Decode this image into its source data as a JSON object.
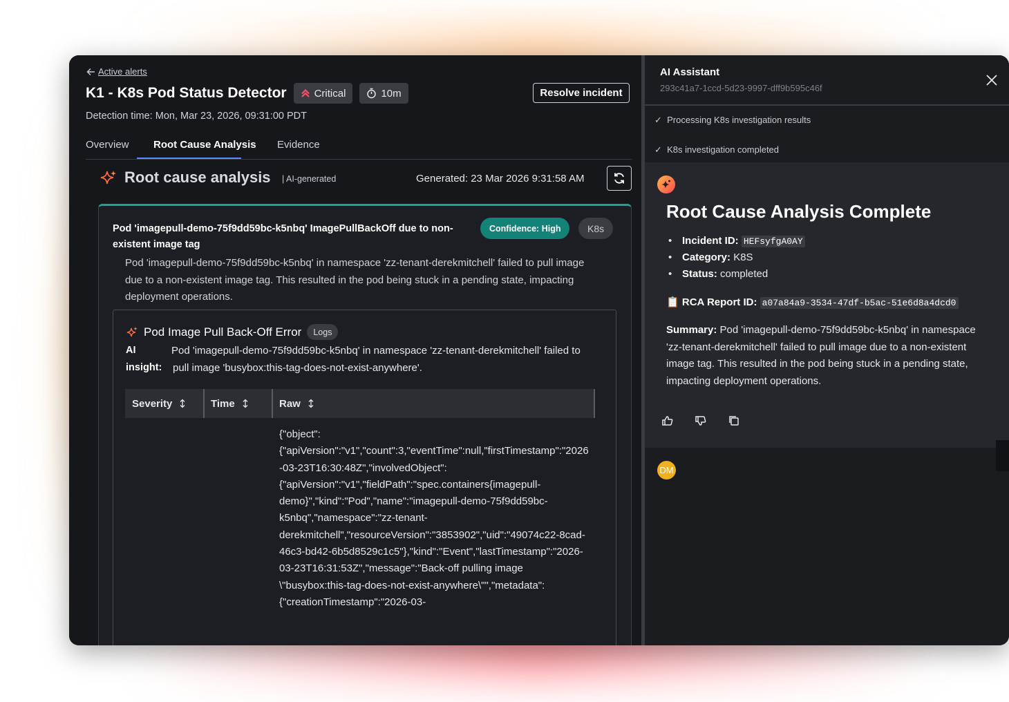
{
  "header": {
    "back_label": "Active alerts",
    "title": "K1 - K8s Pod Status Detector",
    "severity_label": "Critical",
    "duration_label": "10m",
    "resolve_label": "Resolve incident",
    "detection_time": "Detection time: Mon, Mar 23, 2026, 09:31:00 PDT"
  },
  "tabs": [
    {
      "label": "Overview",
      "active": false
    },
    {
      "label": "Root Cause Analysis",
      "active": true
    },
    {
      "label": "Evidence",
      "active": false
    }
  ],
  "rca": {
    "title": "Root cause analysis",
    "ai_generated": "| AI-generated",
    "generated": "Generated: 23 Mar 2026 9:31:58 AM"
  },
  "finding": {
    "title": "Pod 'imagepull-demo-75f9dd59bc-k5nbq' ImagePullBackOff due to non-existent image tag",
    "confidence": "Confidence: High",
    "tag": "K8s",
    "description": "Pod 'imagepull-demo-75f9dd59bc-k5nbq' in namespace 'zz-tenant-derekmitchell' failed to pull image due to a non-existent image tag.  This resulted in the pod being stuck in a pending state, impacting deployment operations.",
    "evidence": {
      "title": "Pod Image Pull Back-Off Error",
      "badge": "Logs",
      "insight_label": "AI insight:",
      "insight": "Pod 'imagepull-demo-75f9dd59bc-k5nbq' in namespace 'zz-tenant-derekmitchell' failed to pull image 'busybox:this-tag-does-not-exist-anywhere'.",
      "columns": [
        "Severity",
        "Time",
        "Raw"
      ],
      "raw": "{\"object\": {\"apiVersion\":\"v1\",\"count\":3,\"eventTime\":null,\"firstTimestamp\":\"2026-03-23T16:30:48Z\",\"involvedObject\": {\"apiVersion\":\"v1\",\"fieldPath\":\"spec.containers{imagepull-demo}\",\"kind\":\"Pod\",\"name\":\"imagepull-demo-75f9dd59bc-k5nbq\",\"namespace\":\"zz-tenant-derekmitchell\",\"resourceVersion\":\"3853902\",\"uid\":\"49074c22-8cad-46c3-bd42-6b5d8529c1c5\"},\"kind\":\"Event\",\"lastTimestamp\":\"2026-03-23T16:31:53Z\",\"message\":\"Back-off pulling image \\\"busybox:this-tag-does-not-exist-anywhere\\\"\",\"metadata\": {\"creationTimestamp\":\"2026-03-"
    }
  },
  "assistant": {
    "title": "AI Assistant",
    "session_id": "293c41a7-1ccd-5d23-9997-dff9b595c46f",
    "steps": [
      "Processing K8s investigation results",
      "K8s investigation completed"
    ],
    "message": {
      "title": "Root Cause Analysis Complete",
      "incident_label": "Incident ID:",
      "incident_id": "HEFsyfgA0AY",
      "category_label": "Category:",
      "category": "K8S",
      "status_label": "Status:",
      "status": "completed",
      "rca_label": "RCA Report ID:",
      "rca_id": "a07a84a9-3534-47df-b5ac-51e6d8a4dcd0",
      "summary_label": "Summary:",
      "summary": "Pod 'imagepull-demo-75f9dd59bc-k5nbq' in namespace 'zz-tenant-derekmitchell' failed to pull image due to a non-existent image tag. This resulted in the pod being stuck in a pending state, impacting deployment operations."
    },
    "user_initials": "DM"
  },
  "colors": {
    "accent": "#5b8cff",
    "confidence_bg": "#138278",
    "critical": "#ff4d6a",
    "card_border": "#1aa39a"
  }
}
